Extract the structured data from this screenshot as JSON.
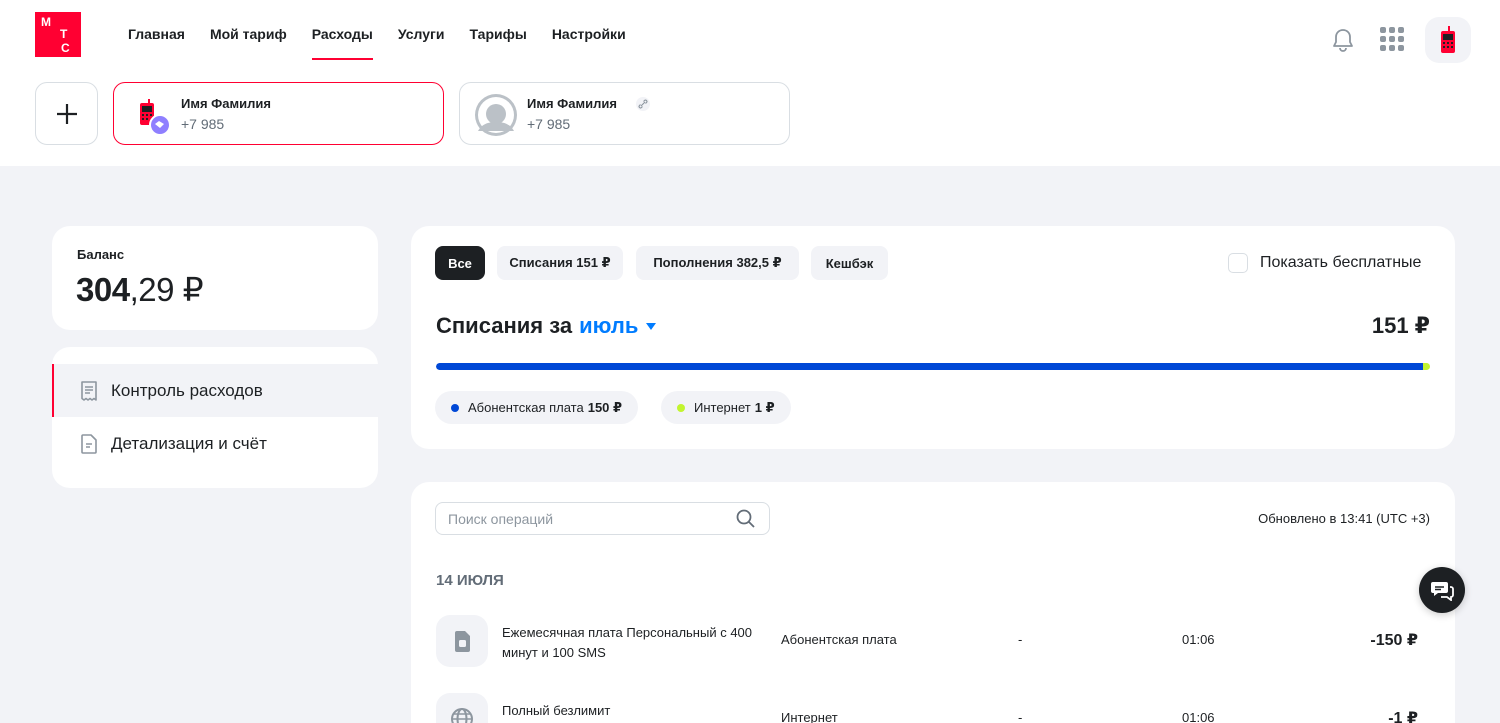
{
  "brand": {
    "logo_letters": [
      "М",
      "Т",
      "С"
    ],
    "accent": "#ff0032",
    "link_color": "#007cff"
  },
  "nav": {
    "items": [
      {
        "label": "Главная"
      },
      {
        "label": "Мой тариф"
      },
      {
        "label": "Расходы",
        "active": true
      },
      {
        "label": "Услуги"
      },
      {
        "label": "Тарифы"
      },
      {
        "label": "Настройки"
      }
    ]
  },
  "header_icons": [
    "bell-icon",
    "apps-grid-icon",
    "user-avatar-phone-icon"
  ],
  "accounts": [
    {
      "name": "Имя Фамилия",
      "phone": "+7 985",
      "selected": true,
      "icon": "red-phone-avatar-icon"
    },
    {
      "name": "Имя Фамилия",
      "phone": "+7 985",
      "selected": false,
      "icon": "default-person-avatar-icon",
      "linked_icon": "link-icon"
    }
  ],
  "balance": {
    "label": "Баланс",
    "integer": "304",
    "fraction": ",29 ₽"
  },
  "sidebar_menu": [
    {
      "label": "Контроль расходов",
      "active": true,
      "icon": "receipt-icon"
    },
    {
      "label": "Детализация и счёт",
      "active": false,
      "icon": "document-icon"
    }
  ],
  "filters": {
    "chips": [
      {
        "label": "Все",
        "active": true
      },
      {
        "label": "Списания 151 ₽",
        "active": false
      },
      {
        "label": "Пополнения 382,5 ₽",
        "active": false
      },
      {
        "label": "Кешбэк",
        "active": false
      }
    ],
    "show_free_label": "Показать бесплатные",
    "show_free_checked": false
  },
  "charges": {
    "title": "Списания за",
    "month": "июль",
    "total": "151 ₽",
    "breakdown": [
      {
        "name": "Абонентская плата",
        "amount": "150 ₽",
        "value": 150,
        "color": "#0048d6"
      },
      {
        "name": "Интернет",
        "amount": "1 ₽",
        "value": 1,
        "color": "#c2f52f"
      }
    ]
  },
  "operations": {
    "search_placeholder": "Поиск операций",
    "updated": "Обновлено в 13:41 (UTC +3)",
    "date_group": "14 ИЮЛЯ",
    "rows": [
      {
        "name": "Ежемесячная плата Персональный с 400 минут и 100 SMS",
        "category": "Абонентская плата",
        "dash": "-",
        "time": "01:06",
        "amount": "-150 ₽",
        "icon": "sim-card-icon"
      },
      {
        "name": "Полный безлимит",
        "category": "Интернет",
        "dash": "-",
        "time": "01:06",
        "amount": "-1 ₽",
        "icon": "globe-icon"
      }
    ]
  }
}
